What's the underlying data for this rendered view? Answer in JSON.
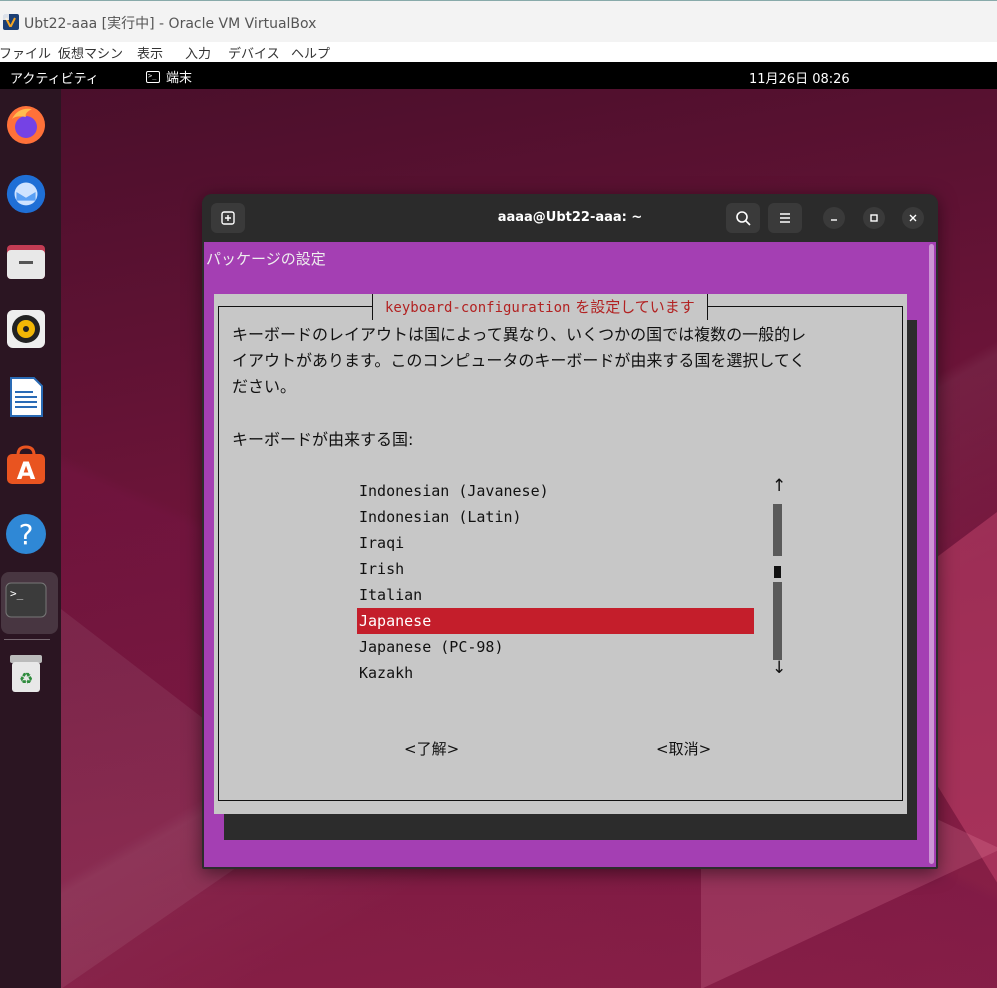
{
  "vbox": {
    "title": "Ubt22-aaa [実行中] - Oracle VM VirtualBox",
    "menu": [
      "ファイル",
      "仮想マシン",
      "表示",
      "入力",
      "デバイス",
      "ヘルプ"
    ]
  },
  "topbar": {
    "activities": "アクティビティ",
    "app_name": "端末",
    "clock": "11月26日  08:26"
  },
  "dock": {
    "apps": [
      "firefox-icon",
      "thunderbird-icon",
      "files-icon",
      "rhythmbox-icon",
      "libreoffice-writer-icon",
      "app-center-icon",
      "help-icon",
      "terminal-icon",
      "trash-icon"
    ]
  },
  "terminal": {
    "title": "aaaa@Ubt22-aaa: ~",
    "package_title": "パッケージの設定",
    "dialog": {
      "title_pkg": "keyboard-configuration",
      "title_suffix": " を設定しています",
      "description_line1": "キーボードのレイアウトは国によって異なり、いくつかの国では複数の一般的レ",
      "description_line2": "イアウトがあります。このコンピュータのキーボードが由来する国を選択してく",
      "description_line3": "ださい。",
      "prompt": "キーボードが由来する国:",
      "options": [
        "Indonesian (Javanese)",
        "Indonesian (Latin)",
        "Iraqi",
        "Irish",
        "Italian",
        "Japanese",
        "Japanese (PC-98)",
        "Kazakh"
      ],
      "selected": "Japanese",
      "ok_button": "<了解>",
      "cancel_button": "<取消>",
      "scroll_up": "↑",
      "scroll_down": "↓"
    }
  },
  "colors": {
    "dialog_bg": "#c7c7c7",
    "whiptail_bg": "#a43fb3",
    "selection": "#c41e2b",
    "title_red": "#b22222"
  }
}
